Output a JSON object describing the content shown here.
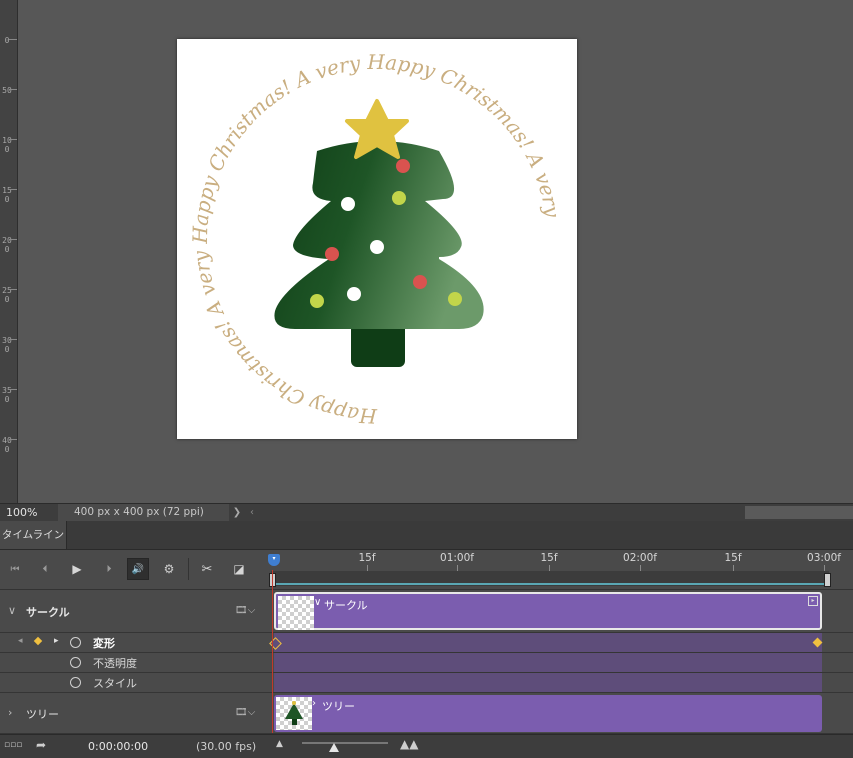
{
  "ruler": {
    "labels": [
      "0",
      "50",
      "100",
      "150",
      "200",
      "250",
      "300",
      "350",
      "400"
    ]
  },
  "document": {
    "ring_text": "Happy Christmas! A very Happy Christmas! A very Happy Christmas! A very ",
    "colors": {
      "ring": "#c9ae80",
      "tree_dark": "#0f3d16",
      "tree_light": "#7fa77a",
      "star": "#e0c240",
      "red": "#d9534f",
      "lime": "#c2d54a",
      "white": "#ffffff"
    }
  },
  "status": {
    "zoom": "100%",
    "doc_size": "400 px x 400 px (72 ppi)",
    "expand_icon": "chevron-right-icon"
  },
  "panel": {
    "tab_label": "タイムライン"
  },
  "controls": {
    "icons": [
      "go-to-first-frame-icon",
      "previous-frame-icon",
      "play-icon",
      "next-frame-icon",
      "audio-icon",
      "settings-gear-icon",
      "split-scissors-icon",
      "transition-icon"
    ]
  },
  "time_ruler": {
    "labels": [
      "15f",
      "01:00f",
      "15f",
      "02:00f",
      "15f",
      "03:00f"
    ]
  },
  "layers": [
    {
      "name": "サークル",
      "expanded": true,
      "clip_label": "サークル",
      "properties": [
        "変形",
        "不透明度",
        "スタイル"
      ]
    },
    {
      "name": "ツリー",
      "expanded": false,
      "clip_label": "ツリー"
    }
  ],
  "bottom": {
    "timecode": "0:00:00:00",
    "fps": "(30.00 fps)"
  },
  "colors": {
    "clip": "#7b5daf",
    "playhead": "#3f7ed0",
    "keyframe": "#f0c040",
    "work_area": "#5aa7b4"
  }
}
